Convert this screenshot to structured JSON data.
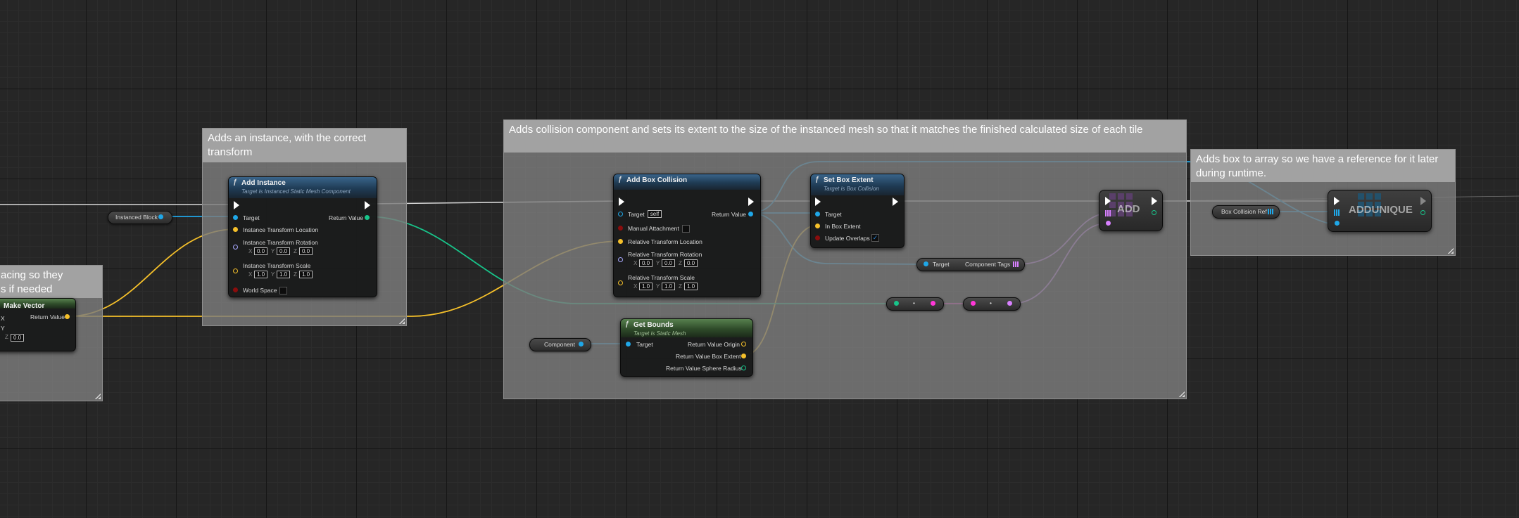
{
  "comments": {
    "spacing": "acing so they\ns if needed",
    "add_instance": "Adds an instance, with the correct transform",
    "collision": "Adds collision component and sets its extent to the size of the instanced mesh so that it matches the finished calculated size of each tile",
    "array": "Adds box to array so we have a reference for it later during runtime."
  },
  "make_vector": {
    "title": "Make Vector",
    "return_value": "Return Value",
    "pin_x": "X",
    "pin_y": "Y",
    "pin_z": "Z",
    "z_value": "0.0"
  },
  "instanced_block": {
    "label": "Instanced Block"
  },
  "add_instance": {
    "title": "Add Instance",
    "subtitle": "Target is Instanced Static Mesh Component",
    "target": "Target",
    "location": "Instance Transform Location",
    "rotation": "Instance Transform Rotation",
    "scale": "Instance Transform Scale",
    "world_space": "World Space",
    "return_value": "Return Value",
    "rot": {
      "x": "0.0",
      "y": "0.0",
      "z": "0.0"
    },
    "scl": {
      "x": "1.0",
      "y": "1.0",
      "z": "1.0"
    }
  },
  "add_box_collision": {
    "title": "Add Box Collision",
    "target": "Target",
    "self": "self",
    "manual_attachment": "Manual Attachment",
    "location": "Relative Transform Location",
    "rotation": "Relative Transform Rotation",
    "scale": "Relative Transform Scale",
    "return_value": "Return Value",
    "rot": {
      "x": "0.0",
      "y": "0.0",
      "z": "0.0"
    },
    "scl": {
      "x": "1.0",
      "y": "1.0",
      "z": "1.0"
    }
  },
  "set_box_extent": {
    "title": "Set Box Extent",
    "subtitle": "Target is Box Collision",
    "target": "Target",
    "in_box_extent": "In Box Extent",
    "update_overlaps": "Update Overlaps"
  },
  "get_bounds": {
    "title": "Get Bounds",
    "subtitle": "Target is Static Mesh",
    "target": "Target",
    "origin": "Return Value Origin",
    "box_extent": "Return Value Box Extent",
    "sphere_radius": "Return Value Sphere Radius"
  },
  "component": {
    "label": "Component"
  },
  "component_tags": {
    "target": "Target",
    "tags": "Component Tags"
  },
  "add": {
    "label": "ADD"
  },
  "box_collision_ref": {
    "label": "Box Collision Ref"
  },
  "add_unique": {
    "label": "ADDUNIQUE"
  },
  "colors": {
    "exec": "#ffffff",
    "object": "#1fa7e8",
    "vector": "#f5c02a",
    "rotator": "#a8a8ff",
    "transform": "#f0a020",
    "bool": "#8a0d0d",
    "struct": "#18c48a",
    "name": "#d880ff",
    "array_pink": "#ff37d8"
  }
}
